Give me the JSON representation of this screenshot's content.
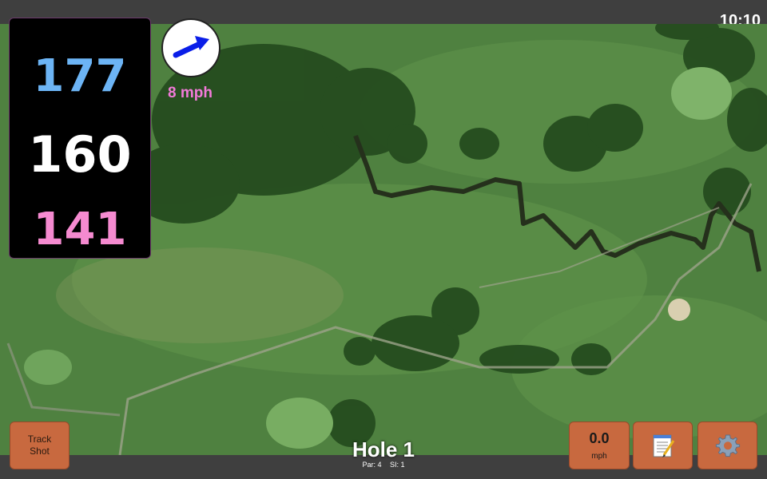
{
  "status": {
    "time": "10:10"
  },
  "distances": {
    "back": "177",
    "middle": "160",
    "front": "141"
  },
  "wind": {
    "speed_label": "8 mph",
    "direction_icon": "wind-arrow-icon",
    "arrow_color": "#0a1ee8"
  },
  "buttons": {
    "track_shot": {
      "line1": "Track",
      "line2": "Shot"
    },
    "speed": {
      "value": "0.0",
      "unit": "mph"
    },
    "notes_icon": "notepad-icon",
    "settings_icon": "gear-icon"
  },
  "hole": {
    "title": "Hole 1",
    "par": "Par: 4",
    "si": "SI: 1"
  },
  "colors": {
    "back_distance": "#6cb4f5",
    "middle_distance": "#ffffff",
    "front_distance": "#f58ad0",
    "wind_text": "#f27ad9",
    "button": "#c8693f"
  }
}
